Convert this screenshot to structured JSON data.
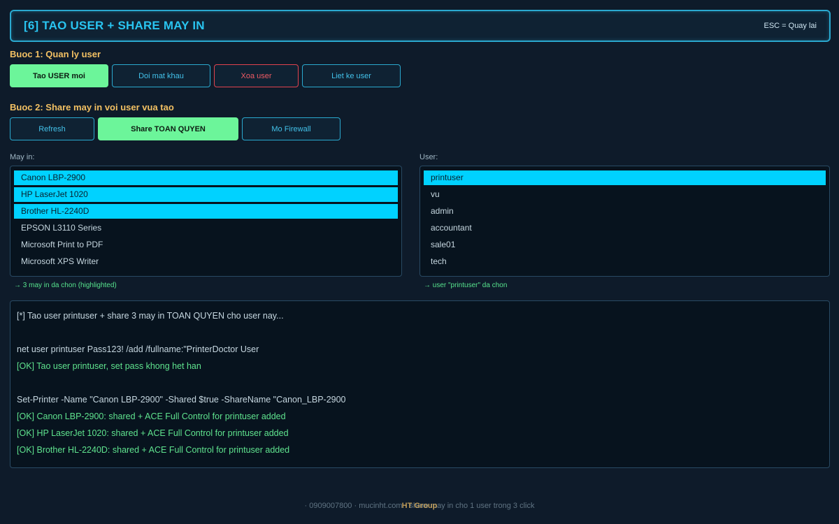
{
  "header": {
    "title": "[6] TAO USER + SHARE MAY IN",
    "hint": "ESC = Quay lai"
  },
  "step1": {
    "title": "Buoc 1: Quan ly user",
    "buttons": {
      "create": "Tao USER moi",
      "change_password": "Doi mat khau",
      "delete": "Xoa user",
      "list": "Liet ke user"
    }
  },
  "step2": {
    "title": "Buoc 2: Share may in voi user vua tao",
    "buttons": {
      "refresh": "Refresh",
      "share_full": "Share TOAN QUYEN",
      "firewall": "Mo Firewall"
    }
  },
  "printers": {
    "label": "May in:",
    "items": [
      {
        "name": "Canon LBP-2900",
        "selected": true
      },
      {
        "name": "HP LaserJet 1020",
        "selected": true
      },
      {
        "name": "Brother HL-2240D",
        "selected": true
      },
      {
        "name": "EPSON L3110 Series",
        "selected": false
      },
      {
        "name": "Microsoft Print to PDF",
        "selected": false
      },
      {
        "name": "Microsoft XPS Writer",
        "selected": false
      }
    ],
    "note": "→ 3 may in da chon (highlighted)"
  },
  "users": {
    "label": "User:",
    "items": [
      {
        "name": "printuser",
        "selected": true
      },
      {
        "name": "vu",
        "selected": false
      },
      {
        "name": "admin",
        "selected": false
      },
      {
        "name": "accountant",
        "selected": false
      },
      {
        "name": "sale01",
        "selected": false
      },
      {
        "name": "tech",
        "selected": false
      }
    ],
    "note": "→ user \"printuser\" da chon"
  },
  "console": {
    "lines": [
      {
        "text": "[*] Tao user printuser + share 3 may in TOAN QUYEN cho user nay...",
        "ok": false
      },
      {
        "text": "",
        "ok": false
      },
      {
        "text": "net user printuser Pass123! /add /fullname:\"PrinterDoctor User",
        "ok": false
      },
      {
        "text": "[OK] Tao user printuser, set pass khong het han",
        "ok": true
      },
      {
        "text": "",
        "ok": false
      },
      {
        "text": "Set-Printer -Name \"Canon LBP-2900\" -Shared $true -ShareName \"Canon_LBP-2900",
        "ok": false
      },
      {
        "text": "[OK] Canon LBP-2900: shared + ACE Full Control for printuser added",
        "ok": true
      },
      {
        "text": "[OK] HP LaserJet 1020: shared + ACE Full Control for printuser added",
        "ok": true
      },
      {
        "text": "[OK] Brother HL-2240D: shared + ACE Full Control for printuser added",
        "ok": true
      }
    ]
  },
  "footer": {
    "text": "· 0909007800 · mucinht.com · share may in cho 1 user trong 3 click",
    "overlay": "HT Group"
  },
  "colors": {
    "background": "#0e1b2a",
    "accent": "#2aa9cf",
    "title": "#29c4f0",
    "step_title": "#f2c063",
    "primary_button": "#6cf59a",
    "danger": "#e0434f",
    "selection": "#00d2ff",
    "ok_text": "#5fe38e"
  }
}
